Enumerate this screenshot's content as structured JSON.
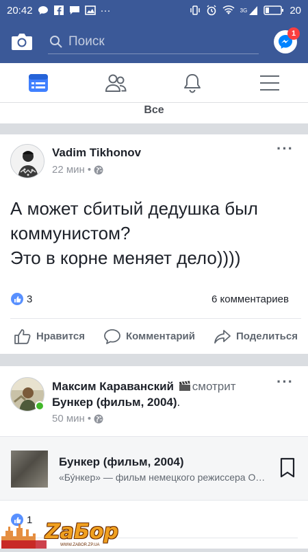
{
  "status_bar": {
    "time": "20:42",
    "dots": "···",
    "battery": "20",
    "network": "3G"
  },
  "header": {
    "search_placeholder": "Поиск",
    "messenger_badge": "1"
  },
  "tabs": [
    {
      "icon": "news-feed-icon",
      "active": true
    },
    {
      "icon": "friends-icon",
      "active": false
    },
    {
      "icon": "bell-icon",
      "active": false
    },
    {
      "icon": "menu-icon",
      "active": false
    }
  ],
  "filter": {
    "label": "Все"
  },
  "posts": [
    {
      "author": "Vadim Tikhonov",
      "time": "22 мин",
      "text_line1": "А может сбитый дедушка был",
      "text_line2": "коммунистом?",
      "text_line3": "Это в корне меняет дело))))",
      "likes": "3",
      "comments": "6 комментариев",
      "actions": {
        "like": "Нравится",
        "comment": "Комментарий",
        "share": "Поделиться"
      }
    },
    {
      "author": "Максим Караванский",
      "activity": "смотрит",
      "activity_object": "Бункер (фильм, 2004)",
      "activity_suffix": ".",
      "time": "50 мин",
      "link_title": "Бункер (фильм, 2004)",
      "link_desc": "«Бу́нкер» — фильм немецкого режиссера Оливера Хиршбигеля",
      "likes": "1"
    }
  ],
  "watermark": {
    "text": "ZаБор",
    "sub": "WWW.ZABOR.ZP.UA"
  },
  "colors": {
    "brand": "#3b5998",
    "like": "#5890ff",
    "badge": "#fa3e3e",
    "online": "#42b72a"
  }
}
